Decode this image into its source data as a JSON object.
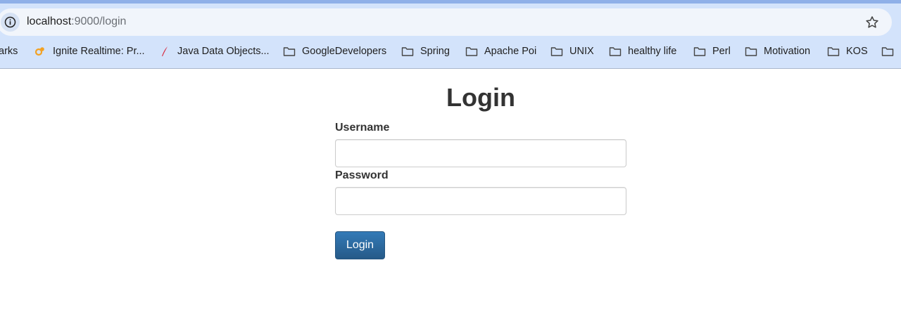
{
  "browser": {
    "url_host": "localhost",
    "url_path": ":9000/login",
    "bookmarks": [
      {
        "label": "arks",
        "icon": "none"
      },
      {
        "label": "Ignite Realtime: Pr...",
        "icon": "ignite-favicon-icon"
      },
      {
        "label": "Java Data Objects...",
        "icon": "feather-favicon-icon"
      },
      {
        "label": "GoogleDevelopers",
        "icon": "folder-icon"
      },
      {
        "label": "Spring",
        "icon": "folder-icon"
      },
      {
        "label": "Apache Poi",
        "icon": "folder-icon"
      },
      {
        "label": "UNIX",
        "icon": "folder-icon"
      },
      {
        "label": "healthy life",
        "icon": "folder-icon"
      },
      {
        "label": "Perl",
        "icon": "folder-icon"
      },
      {
        "label": "Motivation",
        "icon": "folder-icon"
      },
      {
        "label": "KOS",
        "icon": "folder-icon"
      },
      {
        "label": "",
        "icon": "folder-icon"
      }
    ]
  },
  "page": {
    "title": "Login",
    "username_label": "Username",
    "username_value": "",
    "password_label": "Password",
    "password_value": "",
    "submit_label": "Login"
  },
  "colors": {
    "chrome_bg": "#d3e3fb",
    "button_primary": "#337ab7",
    "text": "#333333"
  }
}
